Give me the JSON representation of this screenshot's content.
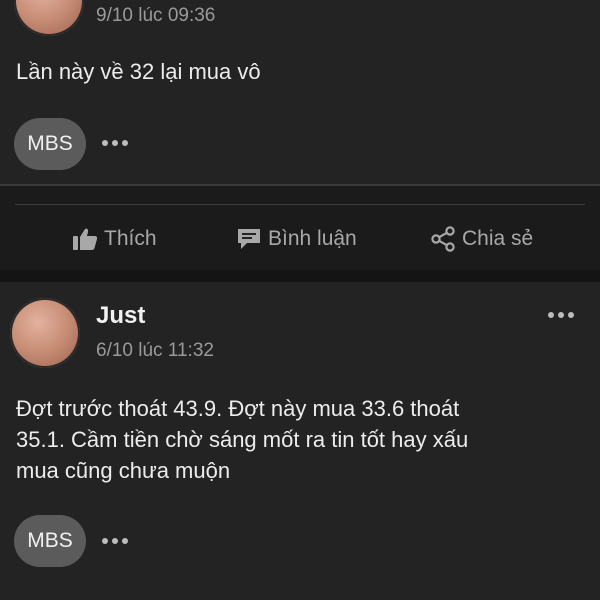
{
  "post1": {
    "timestamp": "9/10 lúc 09:36",
    "content": "Lần này về 32 lại mua vô",
    "chip_label": "MBS"
  },
  "actions": {
    "like_label": "Thích",
    "comment_label": "Bình luận",
    "share_label": "Chia sẻ"
  },
  "post2": {
    "author": "Just",
    "timestamp": "6/10 lúc 11:32",
    "content_lines": [
      "Đợt trước thoát 43.9. Đợt này mua 33.6 thoát",
      "35.1. Cầm tiền chờ sáng mốt ra tin tốt hay xấu",
      "mua cũng chưa muộn"
    ],
    "chip_label": "MBS"
  },
  "icons": {
    "like": "thumbs-up-icon",
    "comment": "comment-icon",
    "share": "share-icon",
    "more": "more-dots-icon"
  }
}
